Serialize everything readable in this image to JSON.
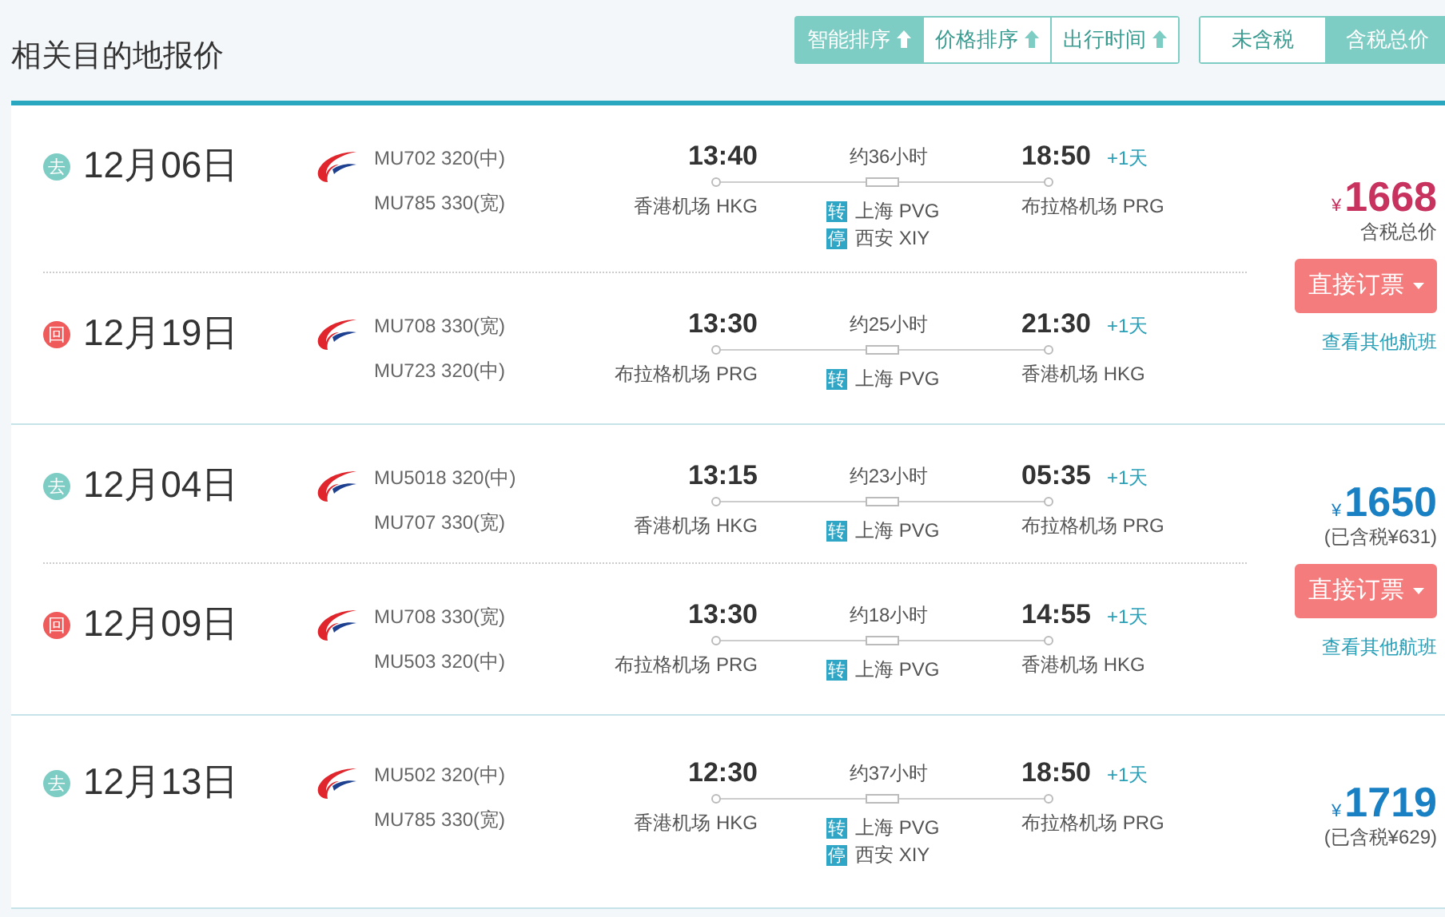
{
  "header": {
    "title": "相关目的地报价",
    "sort_buttons": [
      {
        "label": "智能排序",
        "selected": true
      },
      {
        "label": "价格排序",
        "selected": false
      },
      {
        "label": "出行时间",
        "selected": false
      }
    ],
    "tax_toggle": [
      {
        "label": "未含税",
        "selected": false
      },
      {
        "label": "含税总价",
        "selected": true
      }
    ]
  },
  "offers": [
    {
      "legs": [
        {
          "direction": {
            "kind": "outbound",
            "label": "去"
          },
          "date": "12月06日",
          "flights": [
            "MU702 320(中)",
            "MU785 330(宽)"
          ],
          "depart_time": "13:40",
          "duration": "约36小时",
          "arrive_time": "18:50",
          "day_offset": "+1天",
          "depart_airport": "香港机场 HKG",
          "arrive_airport": "布拉格机场 PRG",
          "stops": [
            {
              "badge": "转",
              "city": "上海 PVG"
            },
            {
              "badge": "停",
              "city": "西安 XIY"
            }
          ]
        },
        {
          "direction": {
            "kind": "return",
            "label": "回"
          },
          "date": "12月19日",
          "flights": [
            "MU708 330(宽)",
            "MU723 320(中)"
          ],
          "depart_time": "13:30",
          "duration": "约25小时",
          "arrive_time": "21:30",
          "day_offset": "+1天",
          "depart_airport": "布拉格机场 PRG",
          "arrive_airport": "香港机场 HKG",
          "stops": [
            {
              "badge": "转",
              "city": "上海 PVG"
            }
          ]
        }
      ],
      "price": {
        "currency": "¥",
        "amount": "1668",
        "note": "含税总价",
        "color": "#c8325e"
      },
      "book_button": "直接订票",
      "other_link": "查看其他航班"
    },
    {
      "legs": [
        {
          "direction": {
            "kind": "outbound",
            "label": "去"
          },
          "date": "12月04日",
          "flights": [
            "MU5018 320(中)",
            "MU707 330(宽)"
          ],
          "depart_time": "13:15",
          "duration": "约23小时",
          "arrive_time": "05:35",
          "day_offset": "+1天",
          "depart_airport": "香港机场 HKG",
          "arrive_airport": "布拉格机场 PRG",
          "stops": [
            {
              "badge": "转",
              "city": "上海 PVG"
            }
          ]
        },
        {
          "direction": {
            "kind": "return",
            "label": "回"
          },
          "date": "12月09日",
          "flights": [
            "MU708 330(宽)",
            "MU503 320(中)"
          ],
          "depart_time": "13:30",
          "duration": "约18小时",
          "arrive_time": "14:55",
          "day_offset": "+1天",
          "depart_airport": "布拉格机场 PRG",
          "arrive_airport": "香港机场 HKG",
          "stops": [
            {
              "badge": "转",
              "city": "上海 PVG"
            }
          ]
        }
      ],
      "price": {
        "currency": "¥",
        "amount": "1650",
        "note": "(已含税¥631)",
        "color": "#1a80c4"
      },
      "book_button": "直接订票",
      "other_link": "查看其他航班"
    },
    {
      "legs": [
        {
          "direction": {
            "kind": "outbound",
            "label": "去"
          },
          "date": "12月13日",
          "flights": [
            "MU502 320(中)",
            "MU785 330(宽)"
          ],
          "depart_time": "12:30",
          "duration": "约37小时",
          "arrive_time": "18:50",
          "day_offset": "+1天",
          "depart_airport": "香港机场 HKG",
          "arrive_airport": "布拉格机场 PRG",
          "stops": [
            {
              "badge": "转",
              "city": "上海 PVG"
            },
            {
              "badge": "停",
              "city": "西安 XIY"
            }
          ]
        }
      ],
      "price": {
        "currency": "¥",
        "amount": "1719",
        "note": "(已含税¥629)",
        "color": "#1a80c4"
      }
    }
  ]
}
